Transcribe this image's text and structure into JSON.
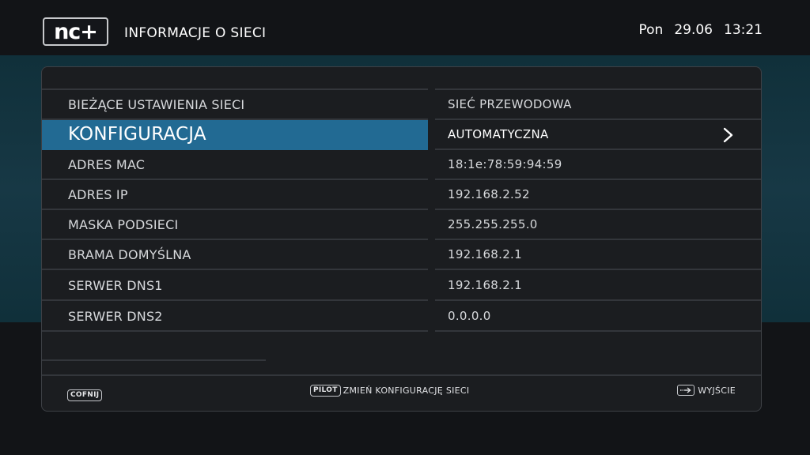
{
  "header": {
    "logo": "nc+",
    "title": "INFORMACJE O SIECI",
    "day": "Pon",
    "date": "29.06",
    "time": "13:21"
  },
  "rows": [
    {
      "label": "BIEŻĄCE USTAWIENIA SIECI",
      "value": "SIEĆ PRZEWODOWA"
    },
    {
      "label": "KONFIGURACJA",
      "value": "AUTOMATYCZNA",
      "selected": true
    },
    {
      "label": "ADRES MAC",
      "value": "18:1e:78:59:94:59"
    },
    {
      "label": "ADRES IP",
      "value": "192.168.2.52"
    },
    {
      "label": "MASKA PODSIECI",
      "value": "255.255.255.0"
    },
    {
      "label": "BRAMA DOMYŚLNA",
      "value": "192.168.2.1"
    },
    {
      "label": "SERWER DNS1",
      "value": "192.168.2.1"
    },
    {
      "label": "SERWER DNS2",
      "value": "0.0.0.0"
    }
  ],
  "footer": {
    "back_key": "COFNIJ",
    "remote_key": "PILOT",
    "remote_action": "ZMIEŃ KONFIGURACJĘ SIECI",
    "exit_label": "WYJŚCIE",
    "exit_icon": "exit-arrow-icon"
  },
  "colors": {
    "selection": "#226a93",
    "band": "#173845",
    "background": "#121417"
  }
}
